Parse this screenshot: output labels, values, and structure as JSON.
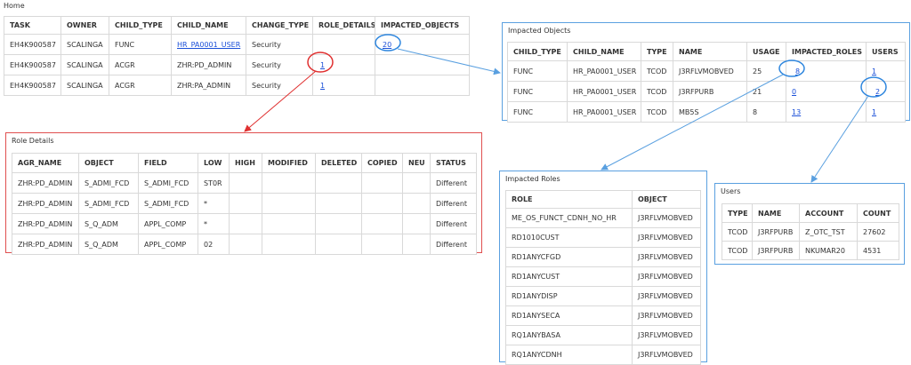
{
  "home": {
    "title": "Home",
    "columns": [
      "TASK",
      "OWNER",
      "CHILD_TYPE",
      "CHILD_NAME",
      "CHANGE_TYPE",
      "ROLE_DETAILS",
      "IMPACTED_OBJECTS"
    ],
    "rows": [
      {
        "task": "EH4K900587",
        "owner": "SCALINGA",
        "child_type": "FUNC",
        "child_name": "HR_PA0001_USER",
        "change_type": "Security",
        "role_details": "",
        "impacted_objects": "20"
      },
      {
        "task": "EH4K900587",
        "owner": "SCALINGA",
        "child_type": "ACGR",
        "child_name": "ZHR:PD_ADMIN",
        "change_type": "Security",
        "role_details": "1",
        "impacted_objects": ""
      },
      {
        "task": "EH4K900587",
        "owner": "SCALINGA",
        "child_type": "ACGR",
        "child_name": "ZHR:PA_ADMIN",
        "change_type": "Security",
        "role_details": "1",
        "impacted_objects": ""
      }
    ]
  },
  "impacted_objects": {
    "title": "Impacted Objects",
    "columns": [
      "CHILD_TYPE",
      "CHILD_NAME",
      "TYPE",
      "NAME",
      "USAGE",
      "IMPACTED_ROLES",
      "USERS"
    ],
    "rows": [
      {
        "child_type": "FUNC",
        "child_name": "HR_PA0001_USER",
        "type": "TCOD",
        "name": "J3RFLVMOBVED",
        "usage": "25",
        "impacted_roles": "8",
        "users": "1"
      },
      {
        "child_type": "FUNC",
        "child_name": "HR_PA0001_USER",
        "type": "TCOD",
        "name": "J3RFPURB",
        "usage": "21",
        "impacted_roles": "0",
        "users": "2"
      },
      {
        "child_type": "FUNC",
        "child_name": "HR_PA0001_USER",
        "type": "TCOD",
        "name": "MB5S",
        "usage": "8",
        "impacted_roles": "13",
        "users": "1"
      }
    ]
  },
  "role_details": {
    "title": "Role Details",
    "columns": [
      "AGR_NAME",
      "OBJECT",
      "FIELD",
      "LOW",
      "HIGH",
      "MODIFIED",
      "DELETED",
      "COPIED",
      "NEU",
      "STATUS"
    ],
    "rows": [
      [
        "ZHR:PD_ADMIN",
        "S_ADMI_FCD",
        "S_ADMI_FCD",
        "ST0R",
        "",
        "",
        "",
        "",
        "",
        "Different"
      ],
      [
        "ZHR:PD_ADMIN",
        "S_ADMI_FCD",
        "S_ADMI_FCD",
        "*",
        "",
        "",
        "",
        "",
        "",
        "Different"
      ],
      [
        "ZHR:PD_ADMIN",
        "S_Q_ADM",
        "APPL_COMP",
        "*",
        "",
        "",
        "",
        "",
        "",
        "Different"
      ],
      [
        "ZHR:PD_ADMIN",
        "S_Q_ADM",
        "APPL_COMP",
        "02",
        "",
        "",
        "",
        "",
        "",
        "Different"
      ]
    ]
  },
  "impacted_roles": {
    "title": "Impacted Roles",
    "columns": [
      "ROLE",
      "OBJECT"
    ],
    "rows": [
      [
        "ME_OS_FUNCT_CDNH_NO_HR",
        "J3RFLVMOBVED"
      ],
      [
        "RD1010CUST",
        "J3RFLVMOBVED"
      ],
      [
        "RD1ANYCFGD",
        "J3RFLVMOBVED"
      ],
      [
        "RD1ANYCUST",
        "J3RFLVMOBVED"
      ],
      [
        "RD1ANYDISP",
        "J3RFLVMOBVED"
      ],
      [
        "RD1ANYSECA",
        "J3RFLVMOBVED"
      ],
      [
        "RQ1ANYBASA",
        "J3RFLVMOBVED"
      ],
      [
        "RQ1ANYCDNH",
        "J3RFLVMOBVED"
      ]
    ]
  },
  "users": {
    "title": "Users",
    "columns": [
      "TYPE",
      "NAME",
      "ACCOUNT",
      "COUNT"
    ],
    "rows": [
      [
        "TCOD",
        "J3RFPURB",
        "Z_OTC_TST",
        "27602"
      ],
      [
        "TCOD",
        "J3RFPURB",
        "NKUMAR20",
        "4531"
      ]
    ]
  },
  "colors": {
    "link": "#1a4fd8",
    "blue_annotation": "#5aa0e0",
    "red_annotation": "#e03030"
  }
}
